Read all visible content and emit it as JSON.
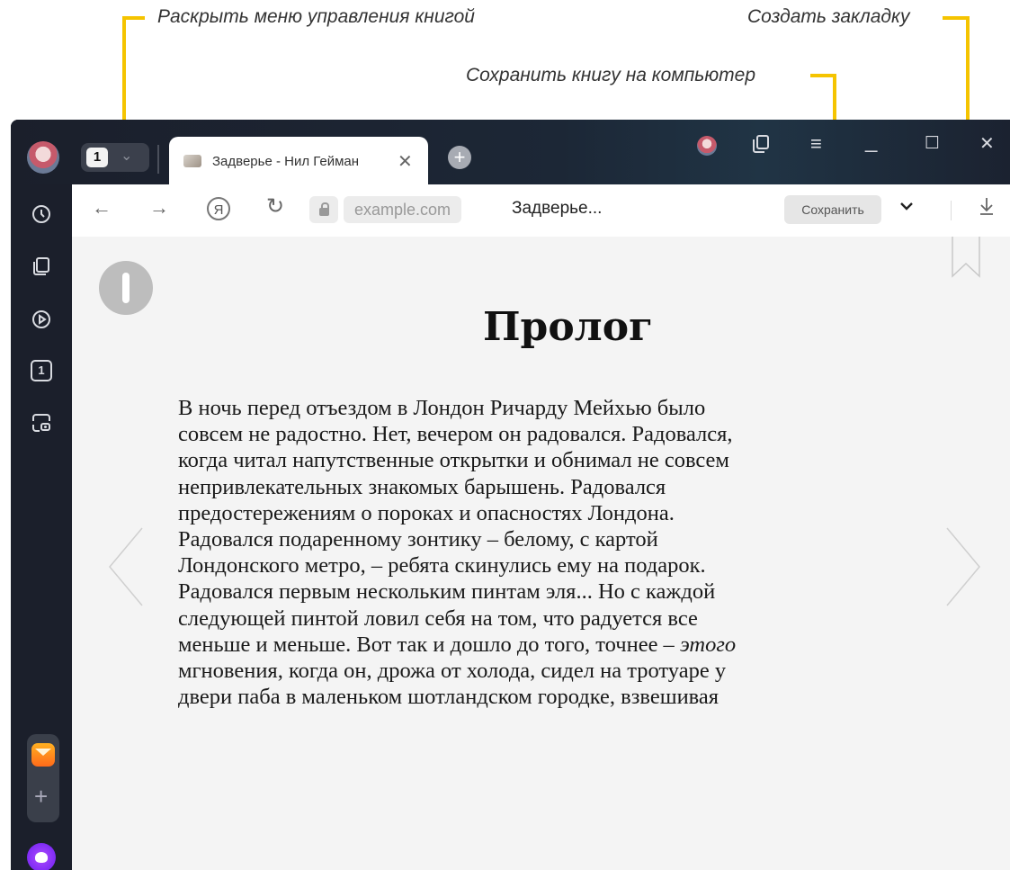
{
  "annotations": {
    "book_menu": "Раскрыть меню управления книгой",
    "bookmark": "Создать закладку",
    "save": "Сохранить книгу на компьютер"
  },
  "accent_color": "#f5c400",
  "tabs": {
    "count": "1",
    "active_title": "Задверье - Нил Гейман",
    "close_glyph": "✕",
    "new_tab_glyph": "+"
  },
  "window_controls": {
    "minimize": "_",
    "maximize": "☐",
    "close": "✕",
    "menu": "≡"
  },
  "toolbar": {
    "back": "←",
    "forward": "→",
    "yandex": "Я",
    "reload": "↻",
    "url": "example.com",
    "page_title": "Задверье...",
    "save_label": "Сохранить",
    "dropdown": "⌄",
    "download": "⤓"
  },
  "sidebar": {
    "icons": [
      "history-icon",
      "collections-icon",
      "video-icon",
      "tabs-counter-icon",
      "screenshot-icon"
    ],
    "tabs_counter": "1",
    "app_plus": "+",
    "more": "•••"
  },
  "reader": {
    "chapter_title": "Пролог",
    "paragraph_lines": [
      "В ночь перед отъездом в Лондон Ричарду Мейхью было",
      "совсем не радостно. Нет, вечером он радовался. Радовался,",
      "когда читал напутственные открытки и обнимал не совсем",
      "непривлекательных знакомых барышень. Радовался",
      "предостережениям о пороках и опасностях Лондона.",
      "Радовался подаренному зонтику – белому, с картой",
      "Лондонского метро, – ребята скинулись ему на подарок.",
      "Радовался первым нескольким пинтам эля... Но с каждой",
      "следующей пинтой ловил себя на том, что радуется все",
      "меньше и меньше. Вот так и дошло до того, точнее – ",
      "мгновения, когда он, дрожа от холода, сидел на тротуаре у",
      "двери паба в маленьком шотландском городке, взвешивая"
    ],
    "italic_word": "этого"
  }
}
